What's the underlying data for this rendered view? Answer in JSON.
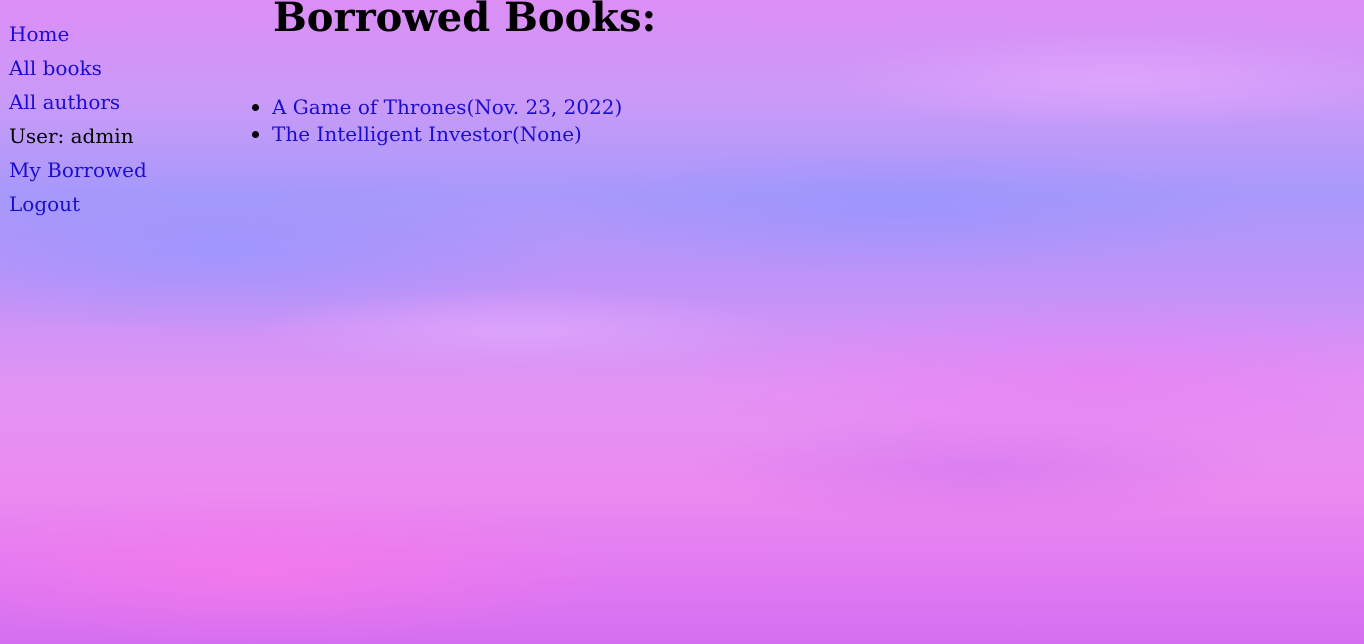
{
  "nav": {
    "home": "Home",
    "all_books": "All books",
    "all_authors": "All authors",
    "user": "User: admin",
    "my_borrowed": "My Borrowed",
    "logout": "Logout"
  },
  "main": {
    "title": "Borrowed Books:",
    "books": [
      {
        "label": "A Game of Thrones(Nov. 23, 2022)"
      },
      {
        "label": "The Intelligent Investor(None)"
      }
    ]
  },
  "colors": {
    "link": "#1a0dcc",
    "text": "#000000"
  }
}
